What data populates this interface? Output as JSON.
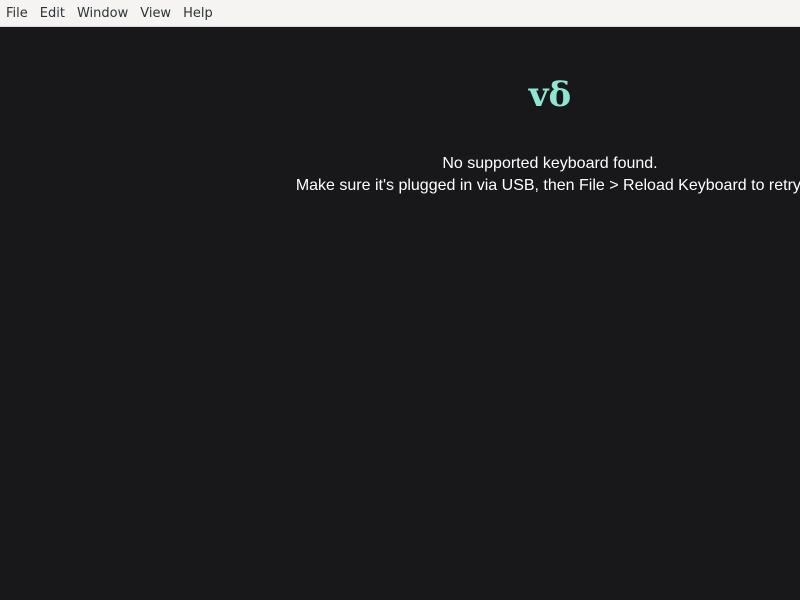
{
  "menubar": {
    "items": [
      {
        "label": "File"
      },
      {
        "label": "Edit"
      },
      {
        "label": "Window"
      },
      {
        "label": "View"
      },
      {
        "label": "Help"
      }
    ]
  },
  "main": {
    "logo": "vδ",
    "message_line1": "No supported keyboard found.",
    "message_line2": "Make sure it's plugged in via USB, then File > Reload Keyboard to retry."
  },
  "colors": {
    "background": "#18181b",
    "menubar": "#f5f4f2",
    "accent": "#8ee6d0",
    "text": "#ffffff"
  }
}
